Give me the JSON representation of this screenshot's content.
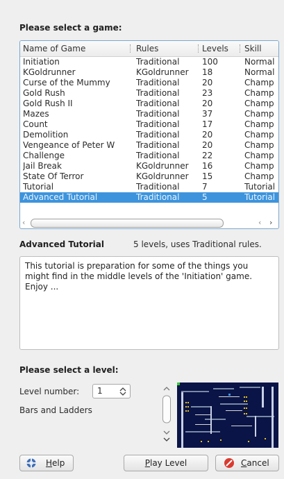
{
  "game_section": {
    "heading": "Please select a game:"
  },
  "columns": {
    "name": "Name of Game",
    "rules": "Rules",
    "levels": "Levels",
    "skill": "Skill"
  },
  "games": [
    {
      "name": "Initiation",
      "rules": "Traditional",
      "levels": "100",
      "skill": "Normal"
    },
    {
      "name": "KGoldrunner",
      "rules": "KGoldrunner",
      "levels": "18",
      "skill": "Normal"
    },
    {
      "name": "Curse of the Mummy",
      "rules": "Traditional",
      "levels": "20",
      "skill": "Champ"
    },
    {
      "name": "Gold Rush",
      "rules": "Traditional",
      "levels": "23",
      "skill": "Champ"
    },
    {
      "name": "Gold Rush II",
      "rules": "Traditional",
      "levels": "20",
      "skill": "Champ"
    },
    {
      "name": "Mazes",
      "rules": "Traditional",
      "levels": "37",
      "skill": "Champ"
    },
    {
      "name": "Count",
      "rules": "Traditional",
      "levels": "17",
      "skill": "Champ"
    },
    {
      "name": "Demolition",
      "rules": "Traditional",
      "levels": "20",
      "skill": "Champ"
    },
    {
      "name": "Vengeance of Peter W",
      "rules": "Traditional",
      "levels": "20",
      "skill": "Champ"
    },
    {
      "name": "Challenge",
      "rules": "Traditional",
      "levels": "22",
      "skill": "Champ"
    },
    {
      "name": "Jail Break",
      "rules": "KGoldrunner",
      "levels": "16",
      "skill": "Champ"
    },
    {
      "name": "State Of Terror",
      "rules": "KGoldrunner",
      "levels": "15",
      "skill": "Champ"
    },
    {
      "name": "Tutorial",
      "rules": "Traditional",
      "levels": "7",
      "skill": "Tutorial"
    },
    {
      "name": "Advanced Tutorial",
      "rules": "Traditional",
      "levels": "5",
      "skill": "Tutorial"
    }
  ],
  "selected_index": 13,
  "selected_game": {
    "title": "Advanced Tutorial",
    "summary": "5 levels, uses Traditional rules."
  },
  "description": "This tutorial is preparation for some of the things you might find in the middle levels of the 'Initiation' game.  Enjoy ...",
  "level_section": {
    "heading": "Please select a level:",
    "number_label": "Level number:",
    "number_value": "1",
    "level_name": "Bars and Ladders"
  },
  "buttons": {
    "help_key": "H",
    "help_rest": "elp",
    "play_key": "P",
    "play_rest": "lay Level",
    "cancel_key": "C",
    "cancel_rest": "ancel"
  },
  "colors": {
    "selection": "#3d94dc",
    "preview_bg": "#0a1446",
    "gold": "#e8c21a"
  }
}
